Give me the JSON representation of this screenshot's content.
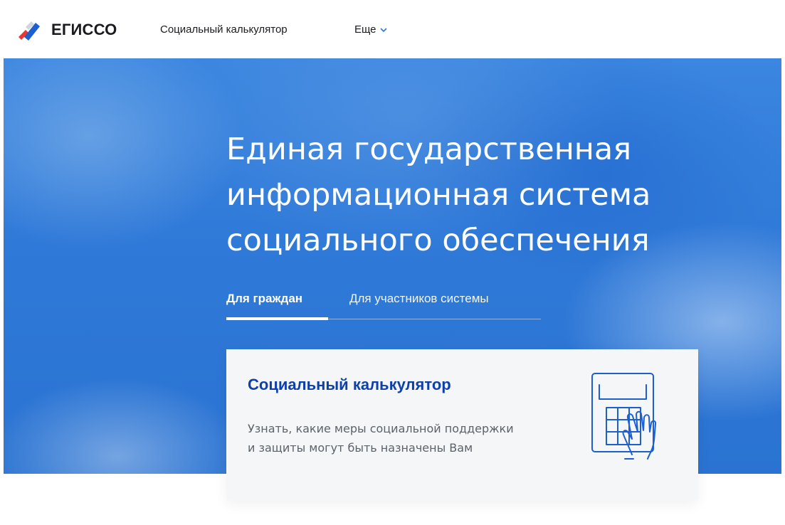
{
  "header": {
    "logo_text": "ЕГИССО",
    "nav": {
      "calculator": "Социальный калькулятор",
      "more": "Еще"
    },
    "icons": {
      "logo": "flag-logo-icon",
      "more": "chevron-down-icon"
    }
  },
  "hero": {
    "title": "Единая государственная информационная система социального обеспечения",
    "tabs": {
      "citizens": "Для граждан",
      "participants": "Для участников системы"
    },
    "active_tab": "citizens"
  },
  "card": {
    "title": "Социальный калькулятор",
    "description": "Узнать, какие меры социальной поддержки и защиты могут быть назначены Вам",
    "icon": "calculator-hand-icon"
  },
  "colors": {
    "accent_blue": "#0f3fa8",
    "hero_blue": "#2f79d8",
    "flag_red": "#e53935",
    "flag_blue": "#1e5fd0",
    "card_bg": "#f4f6f8"
  }
}
